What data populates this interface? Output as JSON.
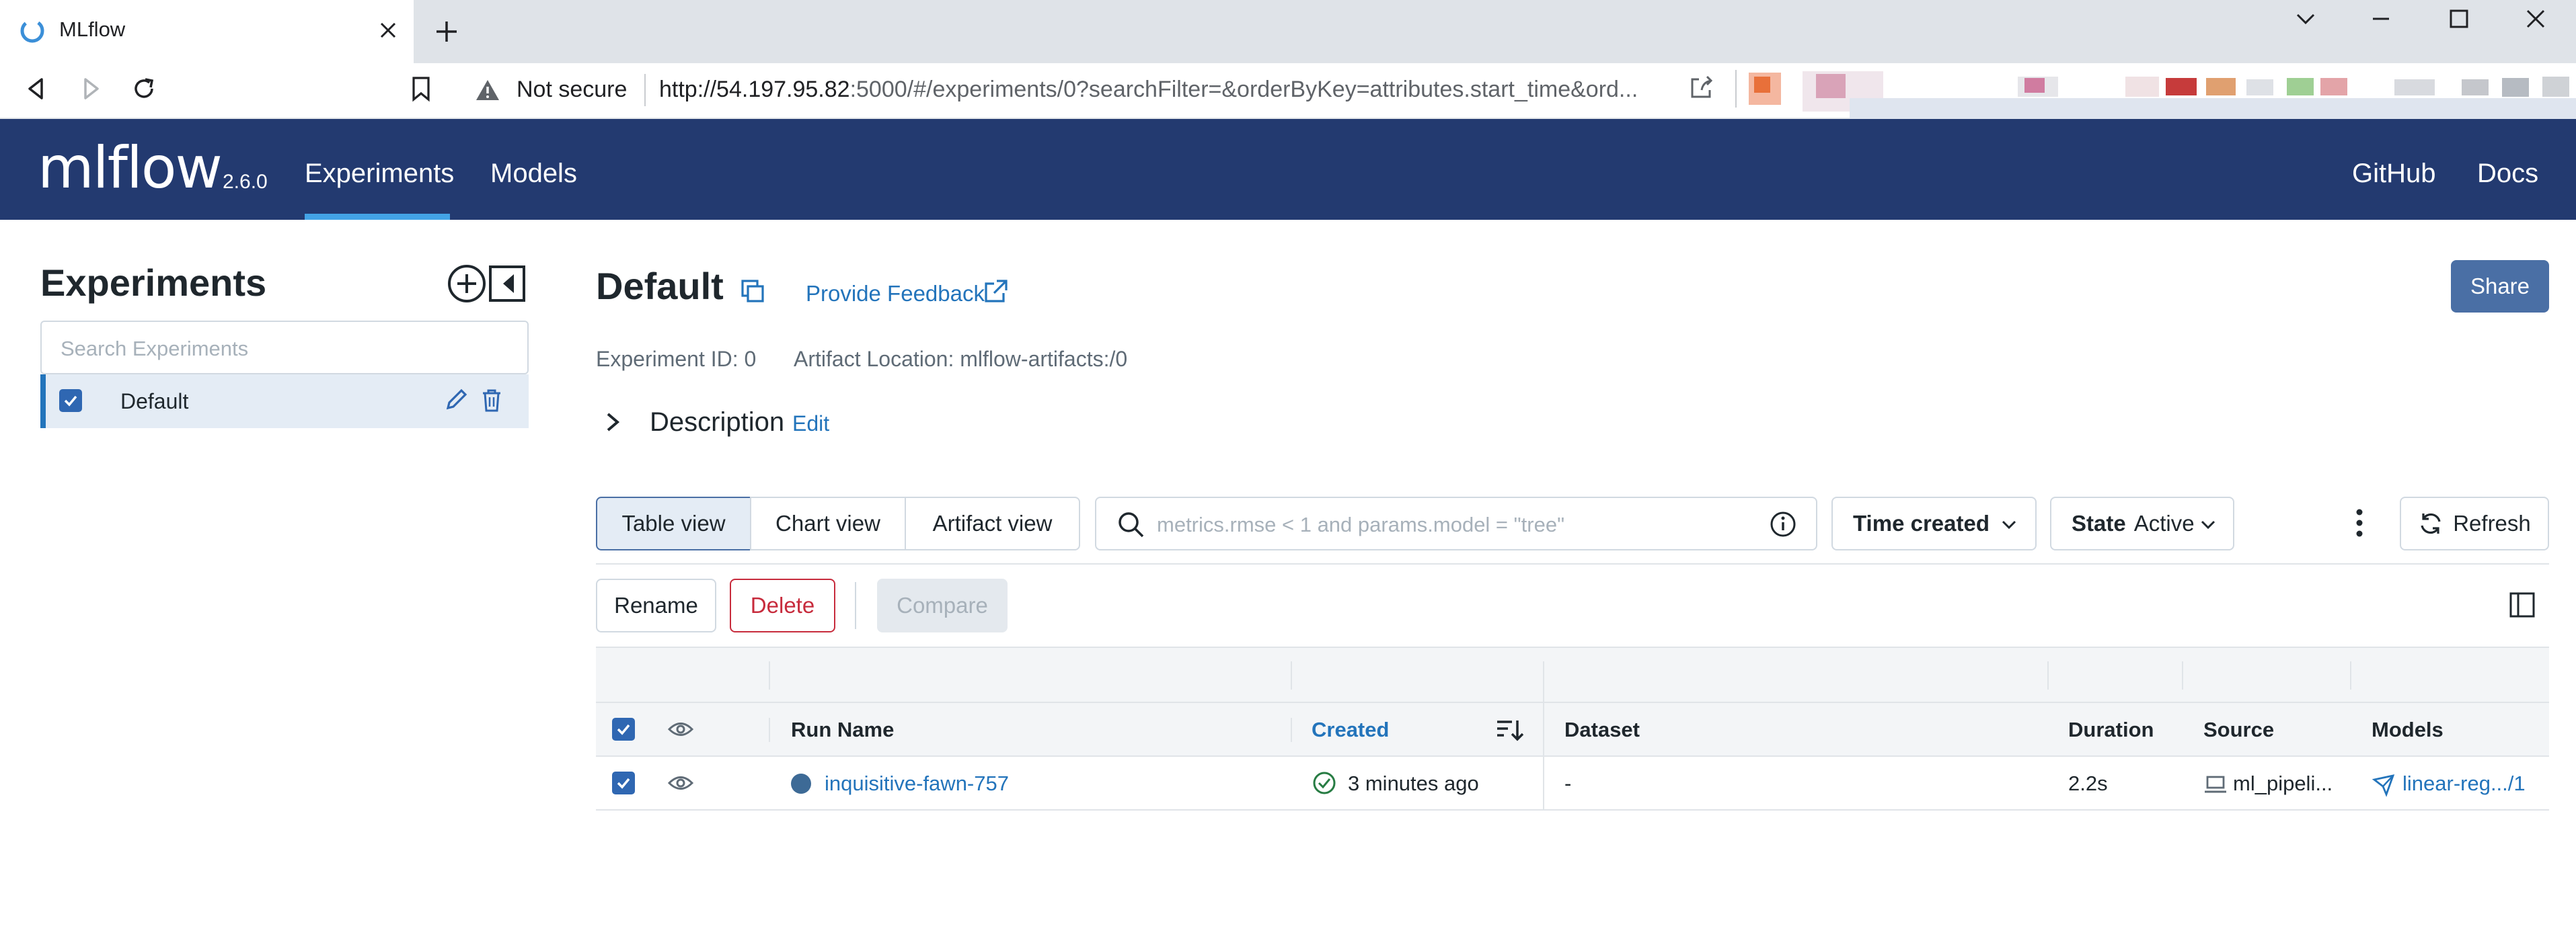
{
  "browser": {
    "tab_title": "MLflow",
    "security_label": "Not secure",
    "url_host": "http://54.197.95.82",
    "url_rest": ":5000/#/experiments/0?searchFilter=&orderByKey=attributes.start_time&ord..."
  },
  "app": {
    "logo_text": "mlflow",
    "version": "2.6.0",
    "nav": [
      "Experiments",
      "Models"
    ],
    "right_nav": [
      "GitHub",
      "Docs"
    ]
  },
  "sidebar": {
    "title": "Experiments",
    "search_placeholder": "Search Experiments",
    "items": [
      {
        "label": "Default"
      }
    ]
  },
  "experiment": {
    "name": "Default",
    "feedback_label": "Provide Feedback",
    "share_label": "Share",
    "id_text": "Experiment ID: 0",
    "artifact_text": "Artifact Location: mlflow-artifacts:/0",
    "description_label": "Description",
    "edit_label": "Edit"
  },
  "toolbar": {
    "views": [
      "Table view",
      "Chart view",
      "Artifact view"
    ],
    "search_placeholder": "metrics.rmse < 1 and params.model = \"tree\"",
    "sort_label": "Time created",
    "state_label": "State",
    "state_value": "Active",
    "refresh_label": "Refresh",
    "rename_label": "Rename",
    "delete_label": "Delete",
    "compare_label": "Compare"
  },
  "table": {
    "columns": [
      "Run Name",
      "Created",
      "Dataset",
      "Duration",
      "Source",
      "Models"
    ],
    "rows": [
      {
        "run_name": "inquisitive-fawn-757",
        "created": "3 minutes ago",
        "dataset": "-",
        "duration": "2.2s",
        "source": "ml_pipeli...",
        "models": "linear-reg.../1"
      }
    ]
  },
  "colors": {
    "header_bg": "#233a70",
    "accent": "#2374bb",
    "primary_button": "#4a6fa5",
    "danger": "#c72b3c",
    "selected_bg": "#e4ecf5"
  }
}
